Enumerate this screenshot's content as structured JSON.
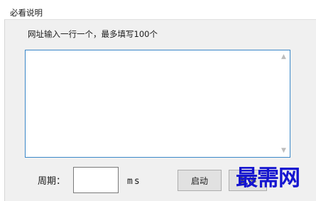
{
  "group": {
    "title": "必看说明"
  },
  "instruction": "网址输入一行一个，最多填写100个",
  "url_input": {
    "value": "",
    "placeholder": ""
  },
  "scrollbar": {
    "up_icon": "scroll-up-arrow",
    "down_icon": "scroll-down-arrow"
  },
  "period": {
    "label": "周期：",
    "value": "",
    "unit": "ms"
  },
  "buttons": {
    "start_label": "启动",
    "stop_label": "暂停"
  },
  "watermark": "最需网",
  "colors": {
    "panel_bg": "#f0f0f0",
    "textarea_border": "#3a87c8",
    "watermark": "#1515d0",
    "button_bg": "#e1e1e1"
  }
}
